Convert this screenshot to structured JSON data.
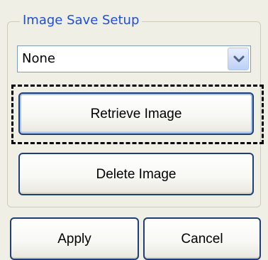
{
  "group": {
    "title": "Image Save Setup"
  },
  "select": {
    "value": "None"
  },
  "buttons": {
    "retrieve": "Retrieve Image",
    "delete": "Delete Image",
    "apply": "Apply",
    "cancel": "Cancel"
  },
  "colors": {
    "background": "#f0efe6",
    "legend_text": "#1f4fd6",
    "button_border": "#1f3f76",
    "dropdown_arrow": "#4d6185"
  },
  "icons": {
    "dropdown": "chevron-down-icon"
  }
}
